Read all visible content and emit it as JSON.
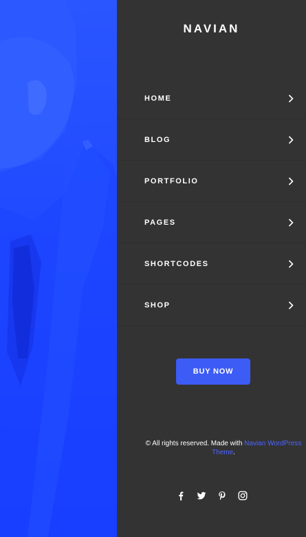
{
  "hero": {
    "image": "man-in-suit-photo",
    "overlay_color": "#2145ff"
  },
  "site": {
    "logo": "NAVIAN"
  },
  "menu": {
    "items": [
      {
        "label": "HOME"
      },
      {
        "label": "BLOG"
      },
      {
        "label": "PORTFOLIO"
      },
      {
        "label": "PAGES"
      },
      {
        "label": "SHORTCODES"
      },
      {
        "label": "SHOP"
      }
    ]
  },
  "cta": {
    "label": "BUY NOW",
    "color": "#3d5bf5"
  },
  "footer": {
    "text_prefix": "© All rights reserved. Made with ",
    "link_text": "Navian WordPress Theme",
    "text_suffix": "."
  },
  "social": {
    "icons": [
      "facebook-icon",
      "twitter-icon",
      "pinterest-icon",
      "instagram-icon"
    ]
  }
}
